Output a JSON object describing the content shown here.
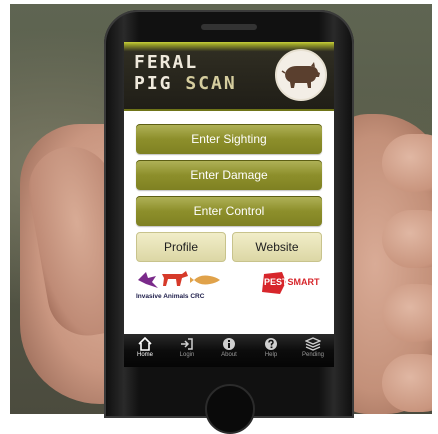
{
  "app": {
    "title_line1": "FERAL",
    "title_line2_a": "PIG",
    "title_line2_b": "SCAN",
    "logo_icon": "pig-icon"
  },
  "buttons": {
    "sighting": "Enter Sighting",
    "damage": "Enter Damage",
    "control": "Enter Control",
    "profile": "Profile",
    "website": "Website"
  },
  "partners": {
    "left_label": "Invasive Animals CRC",
    "right_logo_a": "PEST",
    "right_logo_b": "SMART"
  },
  "tabs": [
    {
      "label": "Home",
      "icon": "home-icon",
      "active": true
    },
    {
      "label": "Login",
      "icon": "login-icon",
      "active": false
    },
    {
      "label": "About",
      "icon": "info-icon",
      "active": false
    },
    {
      "label": "Help",
      "icon": "help-icon",
      "active": false
    },
    {
      "label": "Pending",
      "icon": "layers-icon",
      "active": false
    }
  ],
  "colors": {
    "button_olive": "#8d8f2b",
    "header_dark": "#201e17",
    "header_accent": "#c7cf3e"
  }
}
